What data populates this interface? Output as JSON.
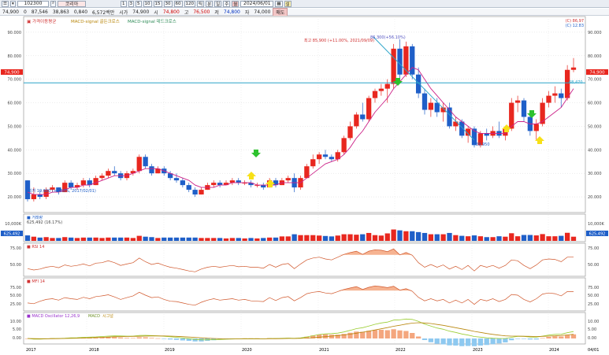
{
  "toolbar": {
    "code": "102300",
    "name": "코리아",
    "periods": [
      "1",
      "3",
      "5",
      "10",
      "15",
      "30",
      "60",
      "120"
    ],
    "tabs": [
      "틱",
      "분",
      "일",
      "주",
      "월"
    ],
    "date": "2024/06/01",
    "mode_label": "설"
  },
  "quote": {
    "price": "74,900",
    "change": "0",
    "change_rate": "87,546",
    "volume": "38,863",
    "amount": "0,840",
    "turnover": "6,572백만",
    "label_open": "시가",
    "open": "74,900",
    "label_high": "시",
    "high": "74,800",
    "label_high2": "고",
    "high2": "76,500",
    "label_low": "저",
    "low": "74,800",
    "label_close": "자",
    "close": "74,000",
    "tag": "매도"
  },
  "price_panel": {
    "legend": [
      "▣ 가격이동평균",
      "MACD-signal 골든크로스",
      "MACD-signal 데드크로스"
    ],
    "top_right": [
      "(C) 86,97",
      "(C) 12.83"
    ],
    "annotations": {
      "peak": "86,300(+56.10%)",
      "peak2": "최고 85,900 (+11.00%, 2021/09/09)",
      "low_label": "최저 19,600 (+1.50%, 2017/02/01)",
      "trend_end": "39,950",
      "hline": "68,470"
    },
    "price_tags": {
      "left": "74,900",
      "right": "74,900"
    },
    "yticks": [
      20,
      30,
      40,
      50,
      60,
      70,
      80,
      90
    ],
    "ytick_labels": [
      "20.000",
      "30.000",
      "40.000",
      "50.000",
      "60.000",
      "70.000",
      "80.000",
      "90.000"
    ]
  },
  "volume_panel": {
    "title": "■ 거래량",
    "value": "625,492 (16.17%)",
    "ytick_label": "10,000K",
    "tag_left": "625,492",
    "tag_right": "625,492"
  },
  "rsi_panel": {
    "title": "■ RSI 14",
    "yticks": [
      "75.00",
      "50.00"
    ]
  },
  "mfi_panel": {
    "title": "■ MFI 14",
    "yticks": [
      "75.00",
      "50.00",
      "25.00"
    ]
  },
  "macd_panel": {
    "title": "■ MACD Oscillator 12,26,9",
    "legend2": "MACD",
    "legend3": "시그널",
    "yticks": [
      "10.00",
      "5.00",
      "0.00"
    ]
  },
  "xaxis": {
    "labels": [
      "2017",
      "2018",
      "2019",
      "2020",
      "2021",
      "2022",
      "2023",
      "2024",
      "04/01"
    ]
  },
  "colors": {
    "up": "#e8271f",
    "down": "#1f5fc8",
    "ma": "#cc2288",
    "hline": "#2aa3c8",
    "trend": "#2aa3c8",
    "rsi": "#d0562a",
    "macd": "#9acd32",
    "signal": "#b8860b",
    "osc_pos": "#f4a67e",
    "osc_neg": "#8ec9f0"
  },
  "chart_data": {
    "type": "candlestick",
    "title": "",
    "x_start": "2017",
    "x_end": "2024",
    "price_range": [
      14,
      96
    ],
    "monthly_ohlc": [
      [
        27,
        27,
        18,
        19
      ],
      [
        19,
        24,
        18,
        21
      ],
      [
        21,
        23,
        19,
        20
      ],
      [
        20,
        24,
        19,
        23
      ],
      [
        23,
        25,
        22,
        24
      ],
      [
        24,
        24,
        21,
        22
      ],
      [
        22,
        27,
        22,
        26
      ],
      [
        26,
        27,
        23,
        24
      ],
      [
        24,
        26,
        23,
        25
      ],
      [
        25,
        28,
        24,
        27
      ],
      [
        27,
        28,
        24,
        25
      ],
      [
        25,
        29,
        25,
        28
      ],
      [
        28,
        30,
        27,
        29
      ],
      [
        29,
        32,
        28,
        31
      ],
      [
        31,
        33,
        29,
        30
      ],
      [
        30,
        31,
        27,
        28
      ],
      [
        28,
        31,
        27,
        30
      ],
      [
        30,
        32,
        29,
        31
      ],
      [
        31,
        38,
        30,
        37
      ],
      [
        37,
        38,
        32,
        33
      ],
      [
        33,
        34,
        29,
        30
      ],
      [
        30,
        33,
        30,
        32
      ],
      [
        32,
        33,
        29,
        30
      ],
      [
        30,
        31,
        27,
        28
      ],
      [
        28,
        30,
        26,
        27
      ],
      [
        27,
        28,
        24,
        25
      ],
      [
        25,
        26,
        22,
        23
      ],
      [
        23,
        24,
        20,
        21
      ],
      [
        21,
        24,
        21,
        23
      ],
      [
        23,
        26,
        23,
        25
      ],
      [
        25,
        27,
        24,
        26
      ],
      [
        26,
        27,
        24,
        25
      ],
      [
        25,
        27,
        25,
        26
      ],
      [
        26,
        28,
        25,
        27
      ],
      [
        27,
        28,
        25,
        26
      ],
      [
        26,
        27,
        25,
        26
      ],
      [
        26,
        27,
        24,
        25
      ],
      [
        25,
        26,
        24,
        25
      ],
      [
        25,
        26,
        23,
        24
      ],
      [
        24,
        28,
        24,
        27
      ],
      [
        27,
        28,
        24,
        25
      ],
      [
        25,
        28,
        25,
        27
      ],
      [
        27,
        29,
        26,
        28
      ],
      [
        28,
        30,
        22,
        24
      ],
      [
        24,
        29,
        23,
        28
      ],
      [
        28,
        34,
        28,
        33
      ],
      [
        33,
        38,
        32,
        36
      ],
      [
        36,
        39,
        34,
        38
      ],
      [
        38,
        40,
        36,
        37
      ],
      [
        37,
        38,
        35,
        36
      ],
      [
        36,
        40,
        35,
        39
      ],
      [
        39,
        46,
        38,
        45
      ],
      [
        45,
        52,
        44,
        50
      ],
      [
        50,
        56,
        49,
        55
      ],
      [
        55,
        60,
        52,
        53
      ],
      [
        53,
        63,
        52,
        62
      ],
      [
        62,
        66,
        60,
        65
      ],
      [
        65,
        68,
        63,
        66
      ],
      [
        66,
        70,
        60,
        68
      ],
      [
        68,
        85,
        66,
        83
      ],
      [
        83,
        87,
        70,
        72
      ],
      [
        72,
        86,
        71,
        84
      ],
      [
        84,
        85,
        70,
        72
      ],
      [
        72,
        75,
        62,
        64
      ],
      [
        64,
        66,
        55,
        57
      ],
      [
        57,
        62,
        54,
        60
      ],
      [
        60,
        62,
        54,
        56
      ],
      [
        56,
        60,
        52,
        58
      ],
      [
        58,
        60,
        49,
        50
      ],
      [
        50,
        54,
        48,
        52
      ],
      [
        52,
        53,
        45,
        46
      ],
      [
        46,
        50,
        43,
        49
      ],
      [
        49,
        50,
        41,
        42
      ],
      [
        42,
        48,
        41,
        47
      ],
      [
        47,
        49,
        44,
        46
      ],
      [
        46,
        50,
        45,
        48
      ],
      [
        48,
        52,
        45,
        46
      ],
      [
        46,
        50,
        44,
        49
      ],
      [
        49,
        62,
        48,
        60
      ],
      [
        60,
        63,
        56,
        61
      ],
      [
        61,
        62,
        52,
        54
      ],
      [
        54,
        56,
        46,
        48
      ],
      [
        48,
        53,
        44,
        51
      ],
      [
        51,
        62,
        50,
        60
      ],
      [
        60,
        65,
        58,
        63
      ],
      [
        63,
        67,
        60,
        64
      ],
      [
        64,
        66,
        58,
        62
      ],
      [
        62,
        76,
        61,
        74
      ],
      [
        74,
        79,
        73,
        75
      ]
    ],
    "ma_values": [
      22,
      21,
      21,
      21,
      22,
      22,
      23,
      24,
      24,
      25,
      25,
      26,
      27,
      28,
      29,
      29,
      29,
      30,
      31,
      32,
      32,
      32,
      31,
      30,
      29,
      28,
      27,
      25,
      24,
      24,
      24,
      25,
      25,
      26,
      26,
      26,
      26,
      25,
      25,
      25,
      25,
      26,
      26,
      26,
      26,
      28,
      30,
      32,
      34,
      35,
      36,
      38,
      41,
      45,
      48,
      52,
      56,
      59,
      62,
      66,
      69,
      72,
      75,
      74,
      70,
      66,
      63,
      60,
      57,
      54,
      52,
      50,
      48,
      47,
      47,
      47,
      47,
      47,
      50,
      52,
      52,
      51,
      51,
      52,
      54,
      56,
      58,
      62,
      66
    ],
    "rsi": [
      45,
      42,
      44,
      48,
      50,
      47,
      53,
      50,
      52,
      55,
      51,
      57,
      58,
      62,
      58,
      52,
      55,
      58,
      68,
      60,
      54,
      57,
      52,
      48,
      46,
      43,
      40,
      38,
      44,
      48,
      50,
      48,
      50,
      52,
      49,
      50,
      48,
      48,
      46,
      54,
      48,
      54,
      56,
      45,
      55,
      64,
      68,
      70,
      66,
      64,
      70,
      76,
      80,
      83,
      76,
      83,
      86,
      85,
      82,
      88,
      75,
      80,
      74,
      58,
      48,
      54,
      48,
      53,
      44,
      50,
      43,
      52,
      40,
      52,
      48,
      52,
      46,
      52,
      64,
      62,
      52,
      45,
      53,
      64,
      66,
      65,
      60,
      70,
      70
    ],
    "mfi": [
      40,
      38,
      45,
      50,
      52,
      48,
      55,
      52,
      50,
      56,
      52,
      58,
      60,
      63,
      57,
      50,
      55,
      60,
      70,
      62,
      55,
      57,
      50,
      45,
      44,
      40,
      36,
      34,
      42,
      48,
      52,
      48,
      50,
      52,
      48,
      50,
      46,
      45,
      44,
      55,
      47,
      55,
      58,
      46,
      55,
      66,
      70,
      72,
      68,
      66,
      72,
      78,
      82,
      86,
      78,
      84,
      88,
      86,
      83,
      87,
      76,
      80,
      73,
      56,
      46,
      52,
      46,
      50,
      40,
      48,
      40,
      50,
      36,
      50,
      46,
      52,
      44,
      50,
      64,
      62,
      50,
      43,
      52,
      65,
      68,
      66,
      60,
      72,
      72
    ],
    "macd": [
      0,
      -0.5,
      -0.5,
      -0.3,
      0,
      0,
      0.2,
      0.5,
      0.6,
      0.9,
      1,
      1.2,
      1.5,
      1.8,
      2,
      1.9,
      1.8,
      1.8,
      2.3,
      2.4,
      2.2,
      2,
      1.7,
      1.3,
      0.9,
      0.4,
      -0.1,
      -0.7,
      -1,
      -1,
      -0.9,
      -0.8,
      -0.6,
      -0.4,
      -0.3,
      -0.2,
      -0.2,
      -0.2,
      -0.3,
      0,
      0,
      0.1,
      0.3,
      0.1,
      0.4,
      1.2,
      2.1,
      3,
      3.5,
      3.7,
      4.1,
      5,
      6.2,
      7.5,
      8.2,
      9.5,
      10.8,
      11.8,
      12.5,
      14,
      14.2,
      14.8,
      14.5,
      13,
      11,
      9.5,
      8,
      7,
      5.6,
      4.6,
      3.4,
      2.6,
      1.5,
      1,
      0.5,
      0.2,
      0,
      0,
      0.9,
      1.6,
      1.6,
      1.1,
      1,
      1.8,
      2.6,
      3.1,
      3.3,
      4.4,
      5.3
    ],
    "signal": [
      0,
      -0.1,
      -0.2,
      -0.2,
      -0.2,
      -0.1,
      0,
      0.1,
      0.2,
      0.4,
      0.5,
      0.7,
      0.9,
      1.1,
      1.3,
      1.4,
      1.5,
      1.6,
      1.7,
      1.8,
      1.9,
      1.9,
      1.9,
      1.8,
      1.6,
      1.4,
      1.1,
      0.8,
      0.5,
      0.2,
      0,
      -0.2,
      -0.3,
      -0.3,
      -0.3,
      -0.3,
      -0.3,
      -0.3,
      -0.3,
      -0.2,
      -0.2,
      -0.1,
      0,
      0,
      0.1,
      0.3,
      0.6,
      1,
      1.4,
      1.8,
      2.2,
      2.7,
      3.3,
      4,
      4.8,
      5.6,
      6.5,
      7.4,
      8.3,
      9.3,
      10.1,
      11,
      11.7,
      12,
      11.8,
      11.4,
      10.7,
      10,
      9.1,
      8.2,
      7.3,
      6.4,
      5.4,
      4.6,
      3.8,
      3.1,
      2.5,
      2,
      1.8,
      1.8,
      1.7,
      1.6,
      1.5,
      1.6,
      1.8,
      2,
      2.3,
      2.7,
      3.2
    ]
  }
}
